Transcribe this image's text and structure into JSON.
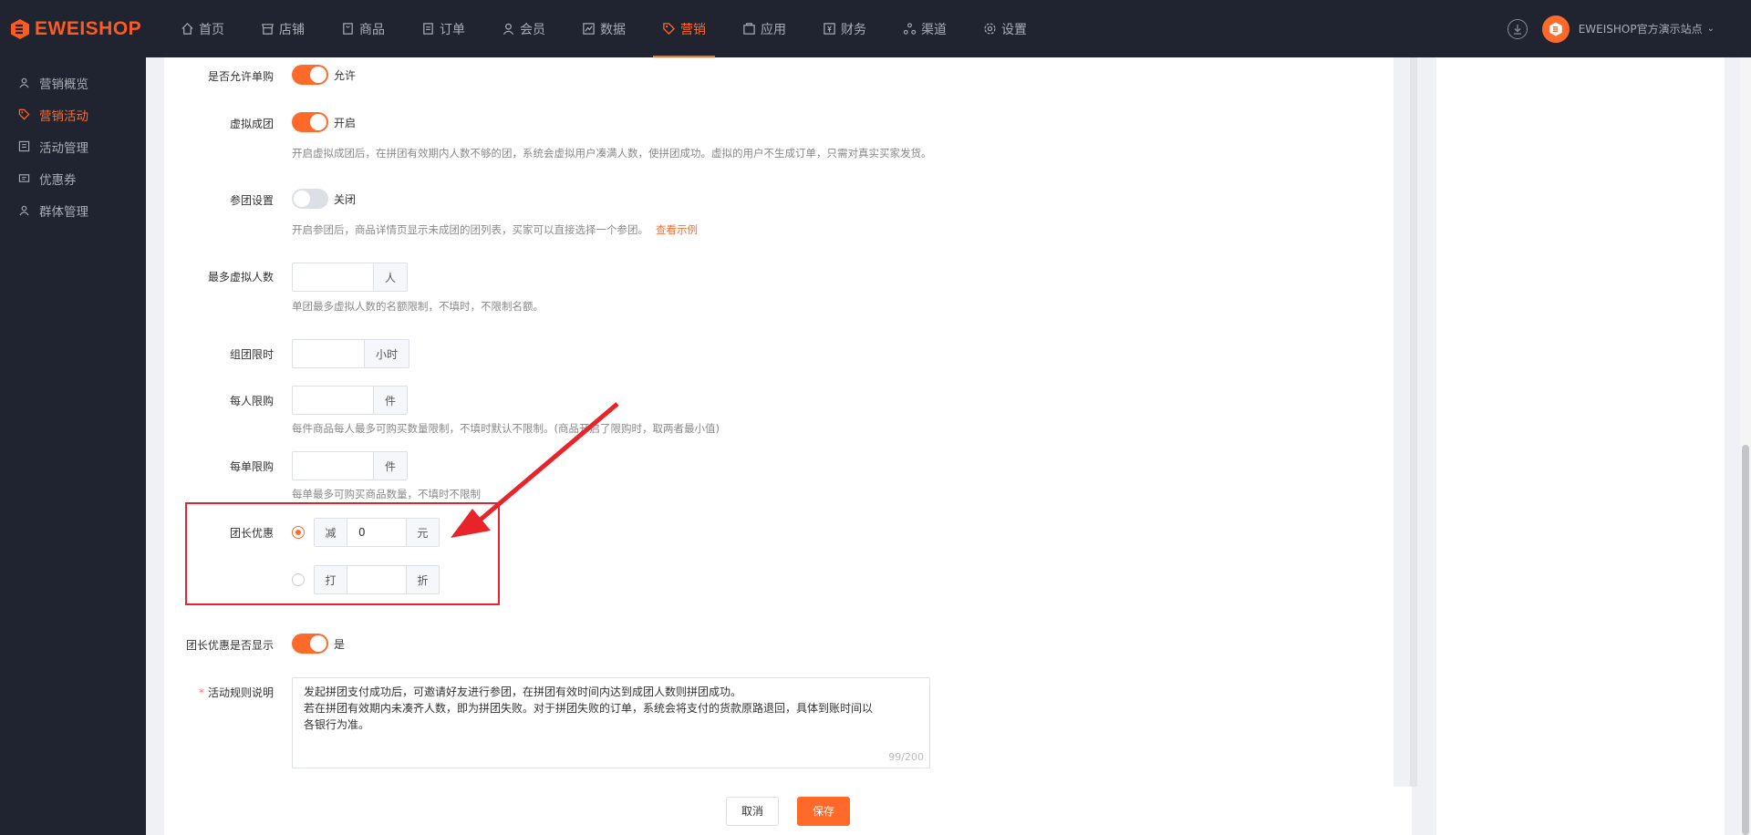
{
  "brand": {
    "name": "EWEISHOP",
    "accent": "#ff6a2a"
  },
  "nav": [
    {
      "label": "首页",
      "icon": "home-icon"
    },
    {
      "label": "店铺",
      "icon": "store-icon"
    },
    {
      "label": "商品",
      "icon": "goods-icon"
    },
    {
      "label": "订单",
      "icon": "order-icon"
    },
    {
      "label": "会员",
      "icon": "member-icon"
    },
    {
      "label": "数据",
      "icon": "chart-icon"
    },
    {
      "label": "营销",
      "icon": "tag-icon",
      "active": true
    },
    {
      "label": "应用",
      "icon": "app-icon"
    },
    {
      "label": "财务",
      "icon": "finance-icon"
    },
    {
      "label": "渠道",
      "icon": "channel-icon"
    },
    {
      "label": "设置",
      "icon": "gear-icon"
    }
  ],
  "store_name": "EWEISHOP官方演示站点",
  "sidebar": [
    {
      "label": "营销概览",
      "icon": "overview-icon"
    },
    {
      "label": "营销活动",
      "icon": "tag-icon",
      "active": true
    },
    {
      "label": "活动管理",
      "icon": "activity-icon"
    },
    {
      "label": "优惠券",
      "icon": "coupon-icon"
    },
    {
      "label": "群体管理",
      "icon": "group-icon"
    }
  ],
  "form": {
    "single_buy": {
      "label": "是否允许单购",
      "value": "允许",
      "on": true
    },
    "virtual_group": {
      "label": "虚拟成团",
      "value": "开启",
      "on": true,
      "help": "开启虚拟成团后，在拼团有效期内人数不够的团，系统会虚拟用户凑满人数，使拼团成功。虚拟的用户不生成订单，只需对真实买家发货。"
    },
    "join_setting": {
      "label": "参团设置",
      "value": "关闭",
      "on": false,
      "help": "开启参团后，商品详情页显示未成团的团列表，买家可以直接选择一个参团。",
      "link": "查看示例"
    },
    "max_virtual": {
      "label": "最多虚拟人数",
      "unit": "人",
      "help": "单团最多虚拟人数的名额限制，不填时，不限制名额。"
    },
    "group_time": {
      "label": "组团限时",
      "unit": "小时"
    },
    "per_person": {
      "label": "每人限购",
      "unit": "件",
      "help": "每件商品每人最多可购买数量限制，不填时默认不限制。(商品开启了限购时，取两者最小值)"
    },
    "per_order": {
      "label": "每单限购",
      "unit": "件",
      "help": "每单最多可购买商品数量，不填时不限制"
    },
    "leader_discount": {
      "label": "团长优惠",
      "reduce": {
        "pre": "减",
        "value": "0",
        "suf": "元",
        "selected": true
      },
      "discount": {
        "pre": "打",
        "value": "",
        "suf": "折",
        "selected": false
      }
    },
    "leader_show": {
      "label": "团长优惠是否显示",
      "value": "是",
      "on": true
    },
    "rules": {
      "label": "活动规则说明",
      "required": "*",
      "lines": [
        "发起拼团支付成功后，可邀请好友进行参团，在拼团有效时间内达到成团人数则拼团成功。",
        "若在拼团有效期内未凑齐人数，即为拼团失败。对于拼团失败的订单，系统会将支付的货款原路退回，具体到账时间以",
        "各银行为准。"
      ],
      "counter": "99/200"
    }
  },
  "footer": {
    "cancel": "取消",
    "save": "保存"
  }
}
